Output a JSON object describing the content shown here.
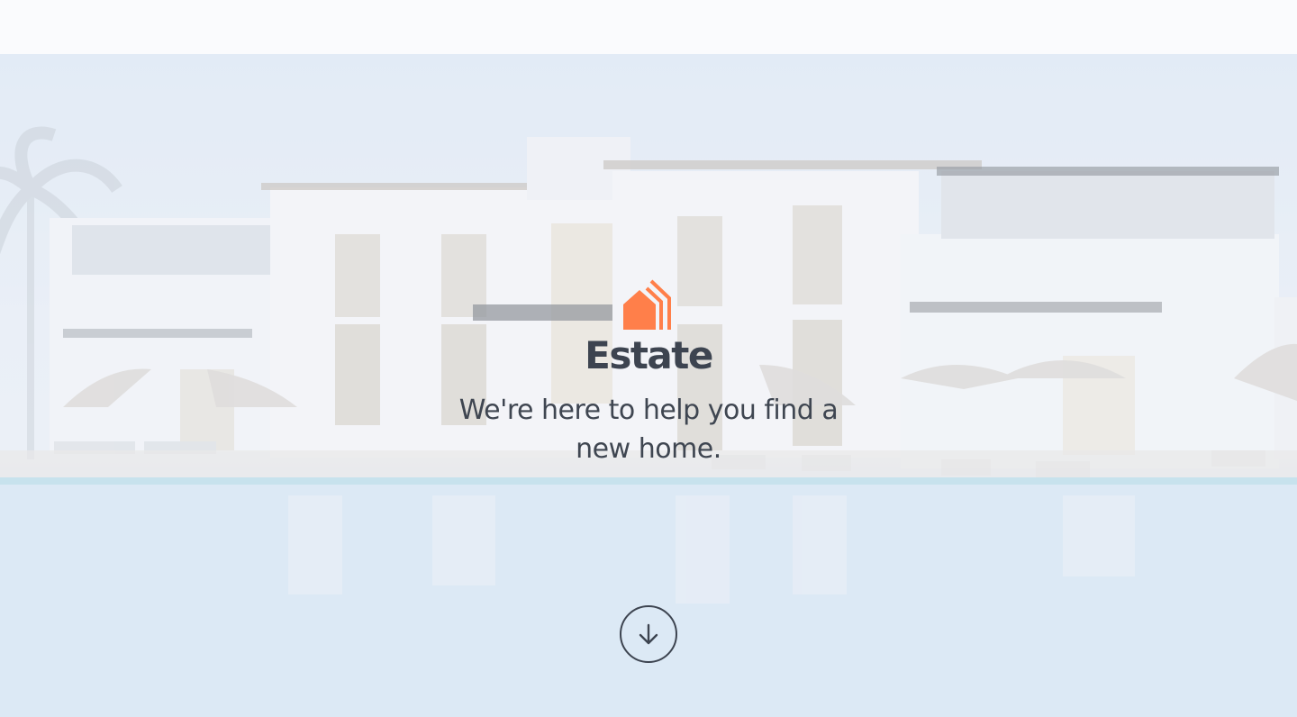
{
  "brand": {
    "name": "Estate",
    "tagline": "We're here to help you find a new home.",
    "accent_color": "#ff7f4a",
    "text_color": "#3d4450",
    "logo_icon": "house-lines-icon"
  },
  "hero": {
    "background": "resort-pool-villa-image"
  },
  "scroll_down": {
    "icon": "arrow-down-icon"
  }
}
